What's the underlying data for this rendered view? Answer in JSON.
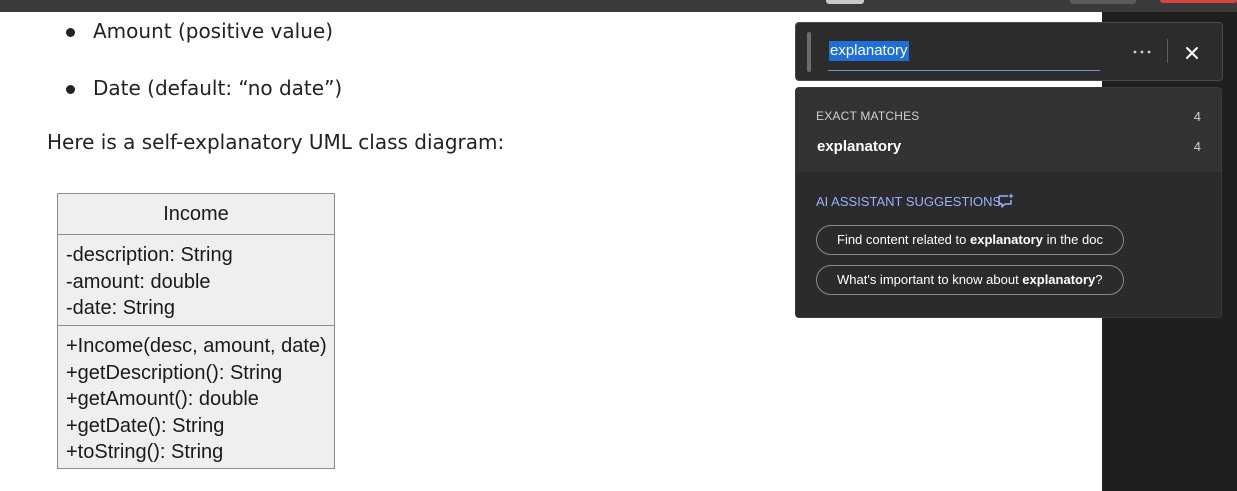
{
  "document": {
    "bullets": [
      "Amount (positive value)",
      "Date (default: “no date”)"
    ],
    "paragraph": "Here is a self-explanatory UML class diagram:",
    "uml": {
      "class_name": "Income",
      "attributes": [
        "-description: String",
        "-amount: double",
        "-date: String"
      ],
      "methods": [
        "+Income(desc, amount, date)",
        "+getDescription(): String",
        "+getAmount(): double",
        "+getDate(): String",
        "+toString(): String"
      ]
    }
  },
  "find": {
    "query": "explanatory",
    "more_icon": "more-horizontal-icon",
    "close_icon": "close-icon"
  },
  "results": {
    "exact_header": "EXACT MATCHES",
    "exact_count": "4",
    "term": "explanatory",
    "term_count": "4",
    "ai_header": "AI ASSISTANT SUGGESTIONS",
    "ai_icon": "sparkle-chat-icon",
    "suggestions": [
      {
        "prefix": "Find content related to ",
        "term": "explanatory",
        "suffix": " in the doc"
      },
      {
        "prefix": "What's important to know about ",
        "term": "explanatory",
        "suffix": "?"
      }
    ]
  },
  "colors": {
    "selection": "#1f6fd8",
    "ai_accent": "#9bb0ff",
    "panel_bg": "#2b2b2b"
  }
}
